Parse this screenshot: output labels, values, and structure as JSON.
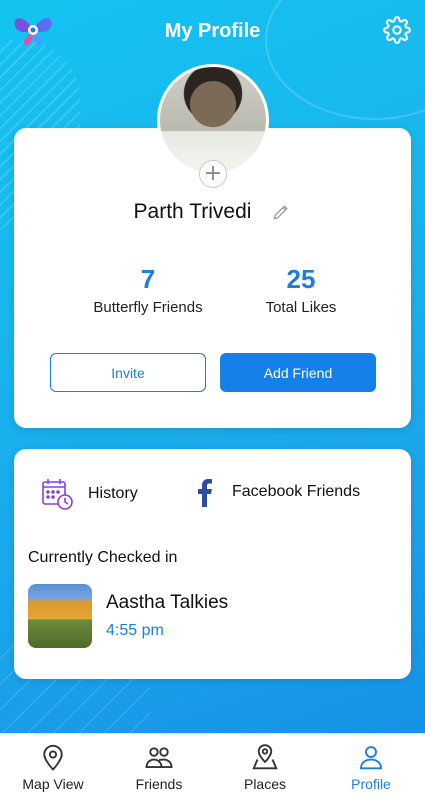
{
  "header": {
    "title": "My Profile"
  },
  "profile": {
    "name": "Parth Trivedi",
    "stats": [
      {
        "value": "7",
        "label": "Butterfly Friends"
      },
      {
        "value": "25",
        "label": "Total Likes"
      }
    ],
    "invite_label": "Invite",
    "add_friend_label": "Add Friend"
  },
  "links": {
    "history_label": "History",
    "facebook_label": "Facebook Friends"
  },
  "checked_in": {
    "title": "Currently Checked in",
    "place_name": "Aastha Talkies",
    "time": "4:55 pm"
  },
  "nav": [
    {
      "label": "Map View",
      "icon": "location-pin-icon"
    },
    {
      "label": "Friends",
      "icon": "friends-icon"
    },
    {
      "label": "Places",
      "icon": "places-icon"
    },
    {
      "label": "Profile",
      "icon": "profile-icon",
      "active": true
    }
  ],
  "colors": {
    "accent": "#1a7fe0",
    "background_top": "#14c3f0",
    "background_bottom": "#1692e6"
  }
}
